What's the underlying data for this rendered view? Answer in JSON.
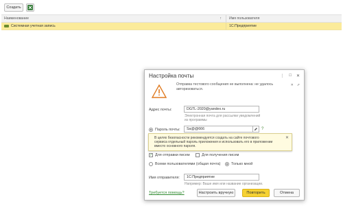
{
  "toolbar": {
    "create_label": "Создать"
  },
  "table": {
    "col_name": "Наименование",
    "col_sort": "↑",
    "col_user": "Имя пользователя",
    "rows": [
      {
        "name": "Системная учетная запись",
        "user": "1С:Предприятие"
      }
    ]
  },
  "dialog": {
    "title": "Настройка почты",
    "controls": {
      "menu": "⋮",
      "maximize": "□",
      "close": "✕"
    },
    "warning": {
      "line1": "Отправка тестового сообщения не выполнена: не удалось",
      "line2": "авторизоваться.",
      "side_close": "✕",
      "side_link": "⇗"
    },
    "email_label": "Адрес почты:",
    "email_value": "DGTL-2020@yandex.ru",
    "email_hint_line1": "Электронная почта для рассылки уведомлений",
    "email_hint_line2": "из программы",
    "password_label": "Пароль почты:",
    "password_value": "Sa@@666",
    "password_help": "?",
    "tooltip": {
      "line1": "В целях безопасности рекомендуется создать на сайте почтового",
      "line2": "сервиса отдельный пароль приложения и использовать его в приложении",
      "line3": "вместо основного пароля.",
      "close": "✕"
    },
    "send_label": "Для отправки писем",
    "receive_label": "Для получения писем",
    "all_users_label": "Всеми пользователями (общая почта)",
    "only_me_label": "Только мной",
    "sender_label": "Имя отправителя:",
    "sender_value": "1С:Предприятие",
    "sender_hint": "Например: Ваше имя или название организации.",
    "help_link": "Требуется помощь?",
    "manual_button": "Настроить вручную",
    "retry_button": "Повторить",
    "cancel_button": "Отмена"
  },
  "colors": {
    "selected_row": "#fbeb9a",
    "primary_button": "#f6d233",
    "link": "#2f8a2f"
  }
}
